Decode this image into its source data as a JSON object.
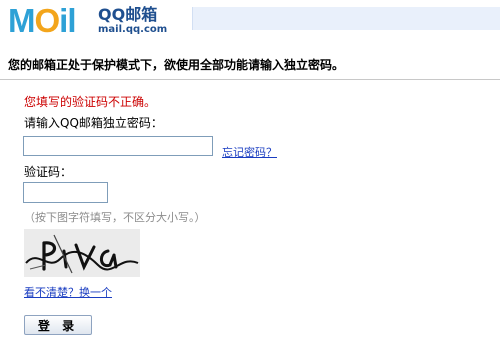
{
  "logo": {
    "wordmark": {
      "m": "M",
      "o": "O",
      "il": "il"
    },
    "title": "QQ邮箱",
    "url": "mail.qq.com"
  },
  "notice": "您的邮箱正处于保护模式下，欲使用全部功能请输入独立密码。",
  "error": "您填写的验证码不正确。",
  "password": {
    "label": "请输入QQ邮箱独立密码：",
    "value": "",
    "forgot_link": "忘记密码？"
  },
  "captcha": {
    "label": "验证码：",
    "value": "",
    "hint": "（按下图字符填写，不区分大小写。）",
    "refresh_link": "看不清楚？换一个"
  },
  "login_button": "登 录"
}
